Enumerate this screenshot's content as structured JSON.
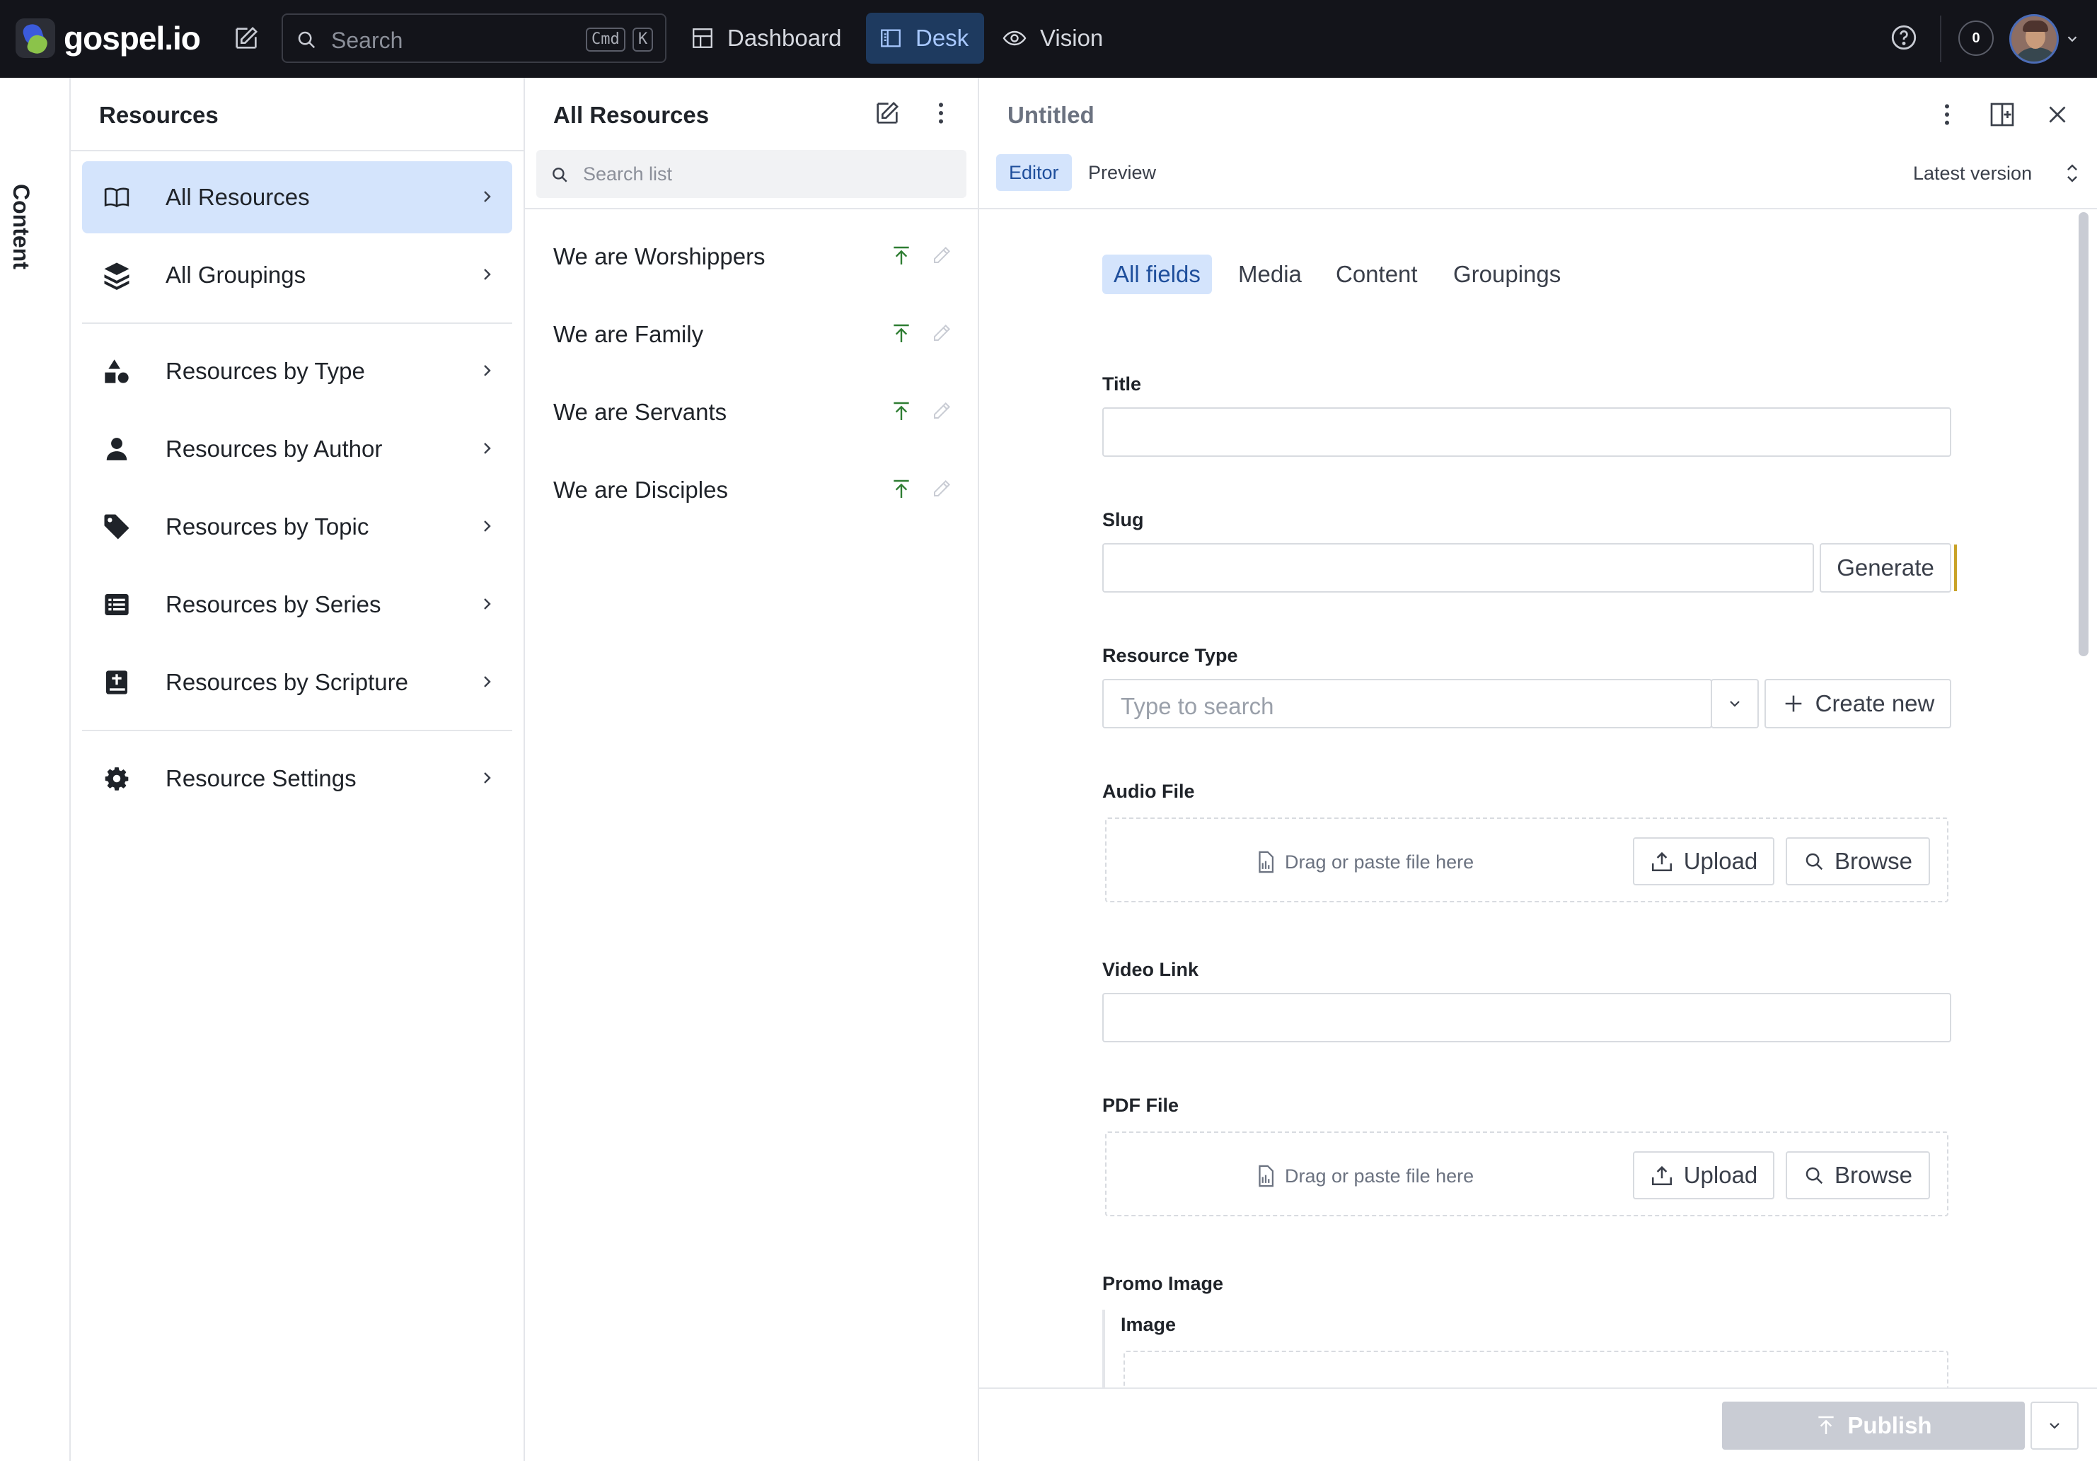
{
  "app": {
    "name": "gospel.io"
  },
  "topbar": {
    "search_placeholder": "Search",
    "shortcut_keys": [
      "Cmd",
      "K"
    ],
    "nav": [
      {
        "label": "Dashboard",
        "icon": "dashboard-icon",
        "active": false
      },
      {
        "label": "Desk",
        "icon": "desk-icon",
        "active": true
      },
      {
        "label": "Vision",
        "icon": "eye-icon",
        "active": false
      }
    ],
    "notifications_count": "0"
  },
  "sidebar_tab": {
    "label": "Content"
  },
  "resources_pane": {
    "title": "Resources",
    "items": [
      {
        "label": "All Resources",
        "icon": "book-icon",
        "active": true
      },
      {
        "label": "All Groupings",
        "icon": "layers-icon",
        "active": false
      },
      {
        "label": "Resources by Type",
        "icon": "shapes-icon",
        "active": false
      },
      {
        "label": "Resources by Author",
        "icon": "person-icon",
        "active": false
      },
      {
        "label": "Resources by Topic",
        "icon": "tag-icon",
        "active": false
      },
      {
        "label": "Resources by Series",
        "icon": "list-icon",
        "active": false
      },
      {
        "label": "Resources by Scripture",
        "icon": "bible-icon",
        "active": false
      },
      {
        "label": "Resource Settings",
        "icon": "gear-icon",
        "active": false
      }
    ]
  },
  "list_pane": {
    "title": "All Resources",
    "search_placeholder": "Search list",
    "documents": [
      {
        "title": "We are Worshippers"
      },
      {
        "title": "We are Family"
      },
      {
        "title": "We are Servants"
      },
      {
        "title": "We are Disciples"
      }
    ]
  },
  "editor": {
    "title": "Untitled",
    "tabs": [
      {
        "label": "Editor",
        "active": true
      },
      {
        "label": "Preview",
        "active": false
      }
    ],
    "version_label": "Latest version",
    "field_groups": [
      {
        "label": "All fields",
        "active": true
      },
      {
        "label": "Media",
        "active": false
      },
      {
        "label": "Content",
        "active": false
      },
      {
        "label": "Groupings",
        "active": false
      }
    ],
    "fields": {
      "title_label": "Title",
      "title_value": "",
      "slug_label": "Slug",
      "slug_value": "",
      "generate_label": "Generate",
      "resource_type_label": "Resource Type",
      "resource_type_placeholder": "Type to search",
      "create_new_label": "Create new",
      "audio_file_label": "Audio File",
      "video_link_label": "Video Link",
      "video_link_value": "",
      "pdf_file_label": "PDF File",
      "promo_image_label": "Promo Image",
      "image_label": "Image"
    },
    "dropzone": {
      "hint": "Drag or paste file here",
      "upload_label": "Upload",
      "browse_label": "Browse"
    },
    "publish_label": "Publish"
  },
  "colors": {
    "topbar_bg": "#13141a",
    "active_nav_bg": "#1e3a5f",
    "selected_item_bg": "#d4e4fc",
    "published_icon": "#2e7d32",
    "publish_button_disabled": "#c9ccd4"
  }
}
